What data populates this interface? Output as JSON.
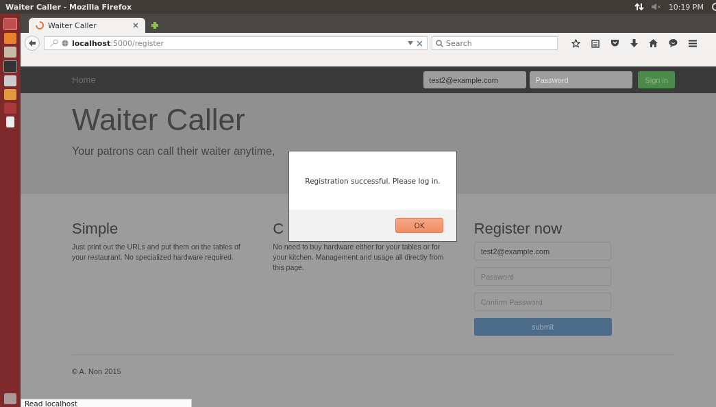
{
  "window": {
    "title": "Waiter Caller - Mozilla Firefox"
  },
  "system_tray": {
    "time": "10:19 PM"
  },
  "tabs": [
    {
      "label": "Waiter Caller",
      "selected": true
    }
  ],
  "url_bar": {
    "host": "localhost",
    "path": ":5000/register"
  },
  "search": {
    "placeholder": "Search"
  },
  "navbar": {
    "brand": "Home",
    "email": {
      "value": "test2@example.com"
    },
    "password": {
      "placeholder": "Password"
    },
    "sign_in": "Sign in"
  },
  "jumbotron": {
    "title": "Waiter Caller",
    "subtitle": "Your patrons can call their waiter anytime,"
  },
  "columns": [
    {
      "heading": "Simple",
      "text": "Just print out the URLs and put them on the tables of your restaurant. No specialized hardware required."
    },
    {
      "heading": "C",
      "text": "No need to buy hardware either for your tables or for your kitchen. Management and usage all directly from this page."
    }
  ],
  "register": {
    "heading": "Register now",
    "fields": [
      {
        "value": "test2@example.com"
      },
      {
        "placeholder": "Password"
      },
      {
        "placeholder": "Confirm Password"
      }
    ],
    "submit": "submit"
  },
  "footer": "© A. Non 2015",
  "dialog": {
    "message": "Registration successful. Please log in.",
    "button": "OK"
  },
  "status_bar": "Read localhost"
}
